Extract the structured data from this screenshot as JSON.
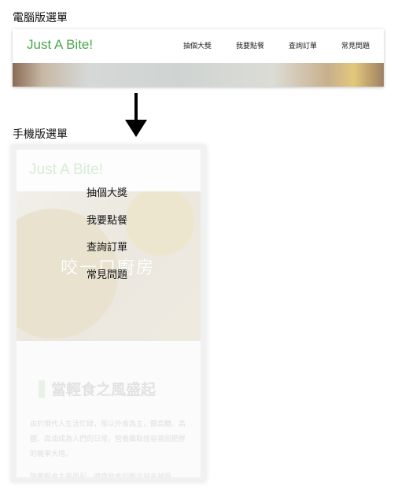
{
  "labels": {
    "desktop_menu": "電腦版選單",
    "mobile_menu": "手機版選單"
  },
  "desktop": {
    "brand": "Just A Bite!",
    "nav_items": [
      "抽個大獎",
      "我要點餐",
      "查詢訂單",
      "常見問題"
    ]
  },
  "mobile": {
    "brand": "Just A Bite!",
    "menu_items": [
      "抽個大獎",
      "我要點餐",
      "查詢訂單",
      "常見問題"
    ],
    "hero_title": "咬一口廚房",
    "section_heading": "當輕食之風盛起",
    "paragraph": "由於現代人生活忙碌，常以外食為主，醬高糖、高鹽、高油成為人們的日常，營養攝取佳容易因肥胖的機率大增。",
    "paragraph2": "隨著輕食主義興起，健康飲食的概念越來越受"
  },
  "colors": {
    "brand_green": "#4ea84d",
    "arrow": "#000000"
  }
}
